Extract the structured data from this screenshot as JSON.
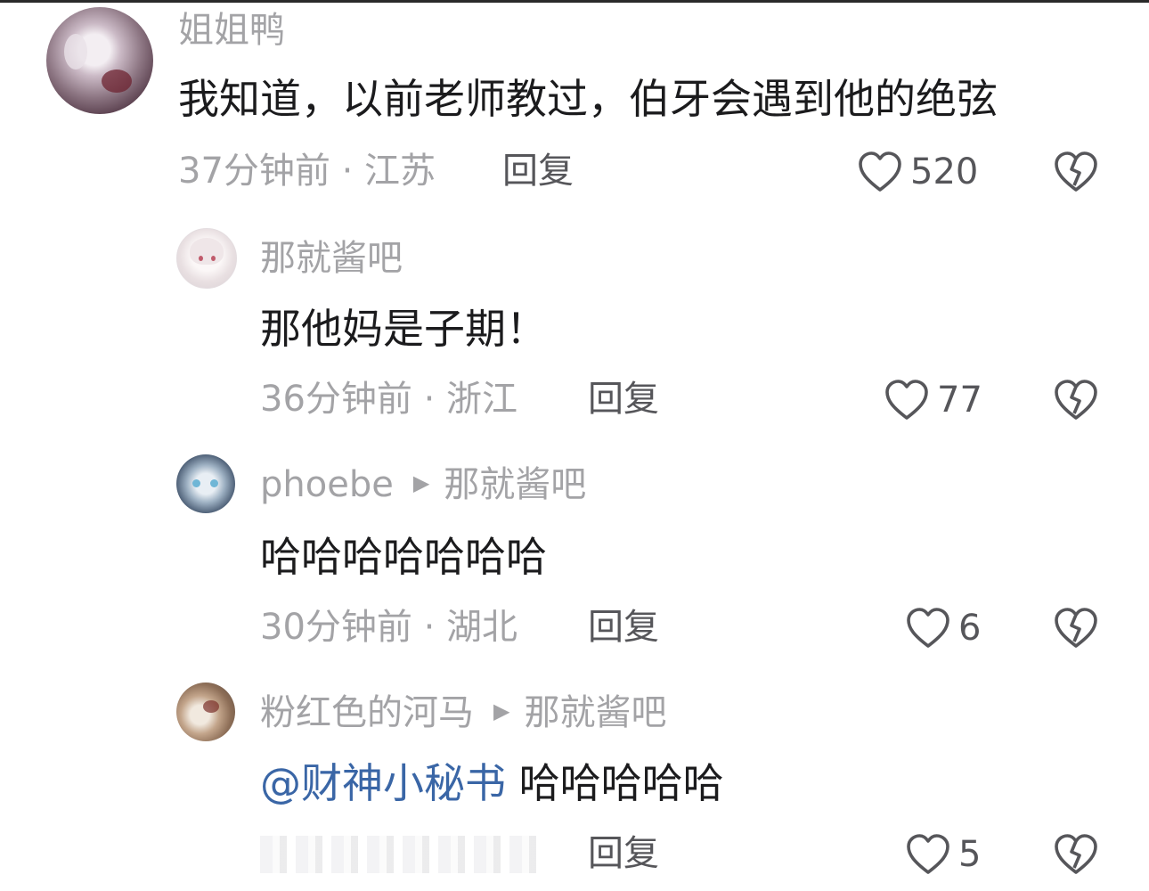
{
  "comments": [
    {
      "username": "姐姐鸭",
      "content": "我知道，以前老师教过，伯牙会遇到他的绝弦",
      "time": "37分钟前 · 江苏",
      "reply_label": "回复",
      "likes": "520"
    },
    {
      "username": "那就酱吧",
      "content": "那他妈是子期！",
      "time": "36分钟前 · 浙江",
      "reply_label": "回复",
      "likes": "77"
    },
    {
      "username": "phoebe",
      "reply_to": "那就酱吧",
      "content": "哈哈哈哈哈哈哈",
      "time": "30分钟前 · 湖北",
      "reply_label": "回复",
      "likes": "6"
    },
    {
      "username": "粉红色的河马",
      "reply_to": "那就酱吧",
      "mention": "@财神小秘书",
      "content": " 哈哈哈哈哈",
      "reply_label": "回复",
      "likes": "5"
    }
  ],
  "icons": {
    "like": "heart-outline-icon",
    "dislike": "broken-heart-icon",
    "reply_arrow": "play-triangle-icon"
  },
  "colors": {
    "text": "#1b1b1d",
    "muted": "#a3a3a6",
    "action": "#56565a",
    "mention": "#3a66a6"
  }
}
